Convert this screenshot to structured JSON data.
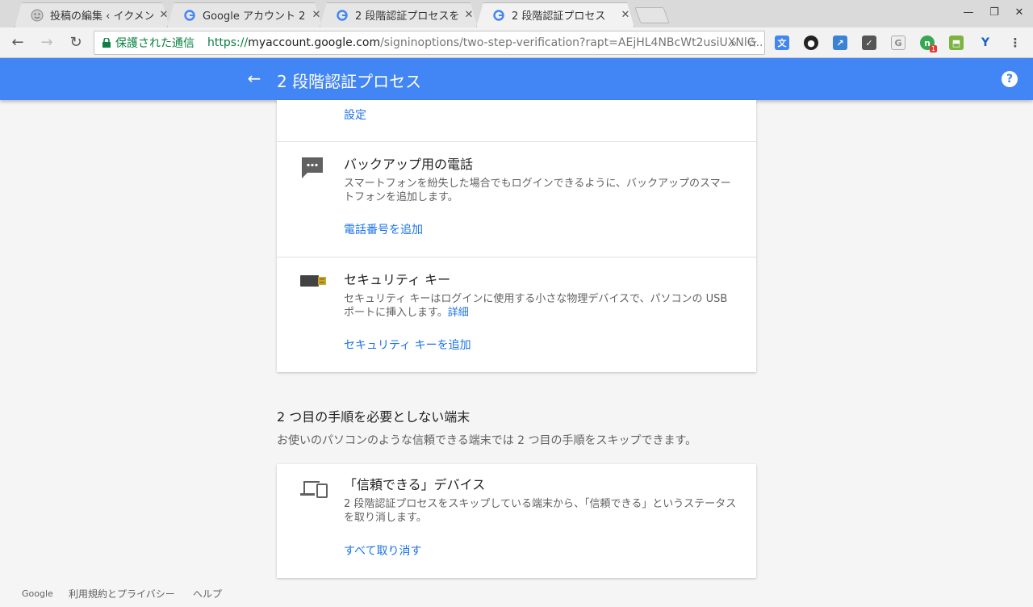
{
  "browser": {
    "tabs": [
      {
        "title": "投稿の編集 ‹ イクメンS",
        "favicon": "smiley-icon",
        "active": false
      },
      {
        "title": "Google アカウント 2 段",
        "favicon": "google-icon",
        "active": false
      },
      {
        "title": "2 段階認証プロセスを",
        "favicon": "google-icon",
        "active": false
      },
      {
        "title": "2 段階認証プロセス",
        "favicon": "google-icon",
        "active": true
      }
    ],
    "close_glyph": "✕",
    "secure_label": "保護された通信",
    "url_scheme": "https://",
    "url_host": "myaccount.google.com",
    "url_path": "/signinoptions/two-step-verification?rapt=AEjHL4NBcWt2usiUXNlG...",
    "extension_badge": "1"
  },
  "appbar": {
    "title": "2 段階認証プロセス",
    "back_glyph": "←",
    "help_glyph": "?"
  },
  "card1": {
    "top_link": "設定",
    "backup_phone": {
      "title": "バックアップ用の電話",
      "description": "スマートフォンを紛失した場合でもログインできるように、バックアップのスマートフォンを追加します。",
      "action": "電話番号を追加"
    },
    "security_key": {
      "title": "セキュリティ キー",
      "description": "セキュリティ キーはログインに使用する小さな物理デバイスで、パソコンの USB ポートに挿入します。",
      "details_link": "詳細",
      "action": "セキュリティ キーを追加"
    }
  },
  "trusted_section": {
    "title": "2 つ目の手順を必要としない端末",
    "description": "お使いのパソコンのような信頼できる端末では 2 つ目の手順をスキップできます。",
    "card": {
      "title": "「信頼できる」デバイス",
      "description": "2 段階認証プロセスをスキップしている端末から、「信頼できる」というステータスを取り消します。",
      "action": "すべて取り消す"
    }
  },
  "footer": {
    "google": "Google",
    "terms": "利用規約とプライバシー",
    "help": "ヘルプ"
  },
  "colors": {
    "accent": "#4285f4",
    "link": "#1a73e8",
    "secure_green": "#0b8043"
  }
}
